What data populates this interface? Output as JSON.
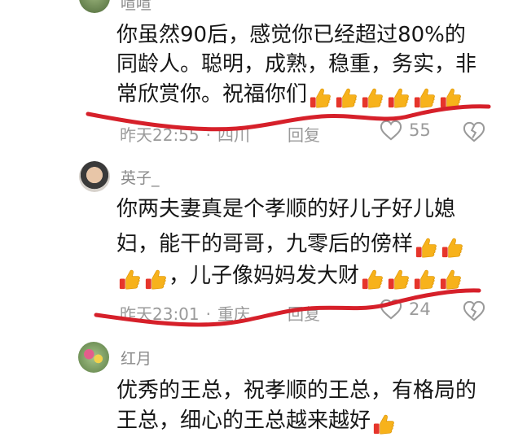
{
  "comments": [
    {
      "username": "喧喧",
      "lines": [
        "你虽然90后，感觉你已经超过80%的",
        "同龄人。聪明，成熟，稳重，务实，非",
        "常欣赏你。祝福你们"
      ],
      "emoji_count_line3": 6,
      "time": "昨天22:55",
      "location": "四川",
      "reply_label": "回复",
      "likes": "55"
    },
    {
      "username": "英子_",
      "lines": [
        "你两夫妻真是个孝顺的好儿子好儿媳",
        "妇，能干的哥哥，九零后的傍样",
        "，儿子像妈妈发大财"
      ],
      "time": "昨天23:01",
      "location": "重庆",
      "reply_label": "回复",
      "likes": "24"
    },
    {
      "username": "红月",
      "lines": [
        "优秀的王总，祝孝顺的王总，有格局的",
        "王总，细心的王总越来越好"
      ]
    }
  ],
  "colors": {
    "scribble": "#d6202a",
    "thumb": "#f7b21b",
    "meta": "#9a9a9a"
  },
  "icons": [
    "thumbs-up-emoji",
    "heart-outline-icon",
    "broken-heart-icon"
  ]
}
